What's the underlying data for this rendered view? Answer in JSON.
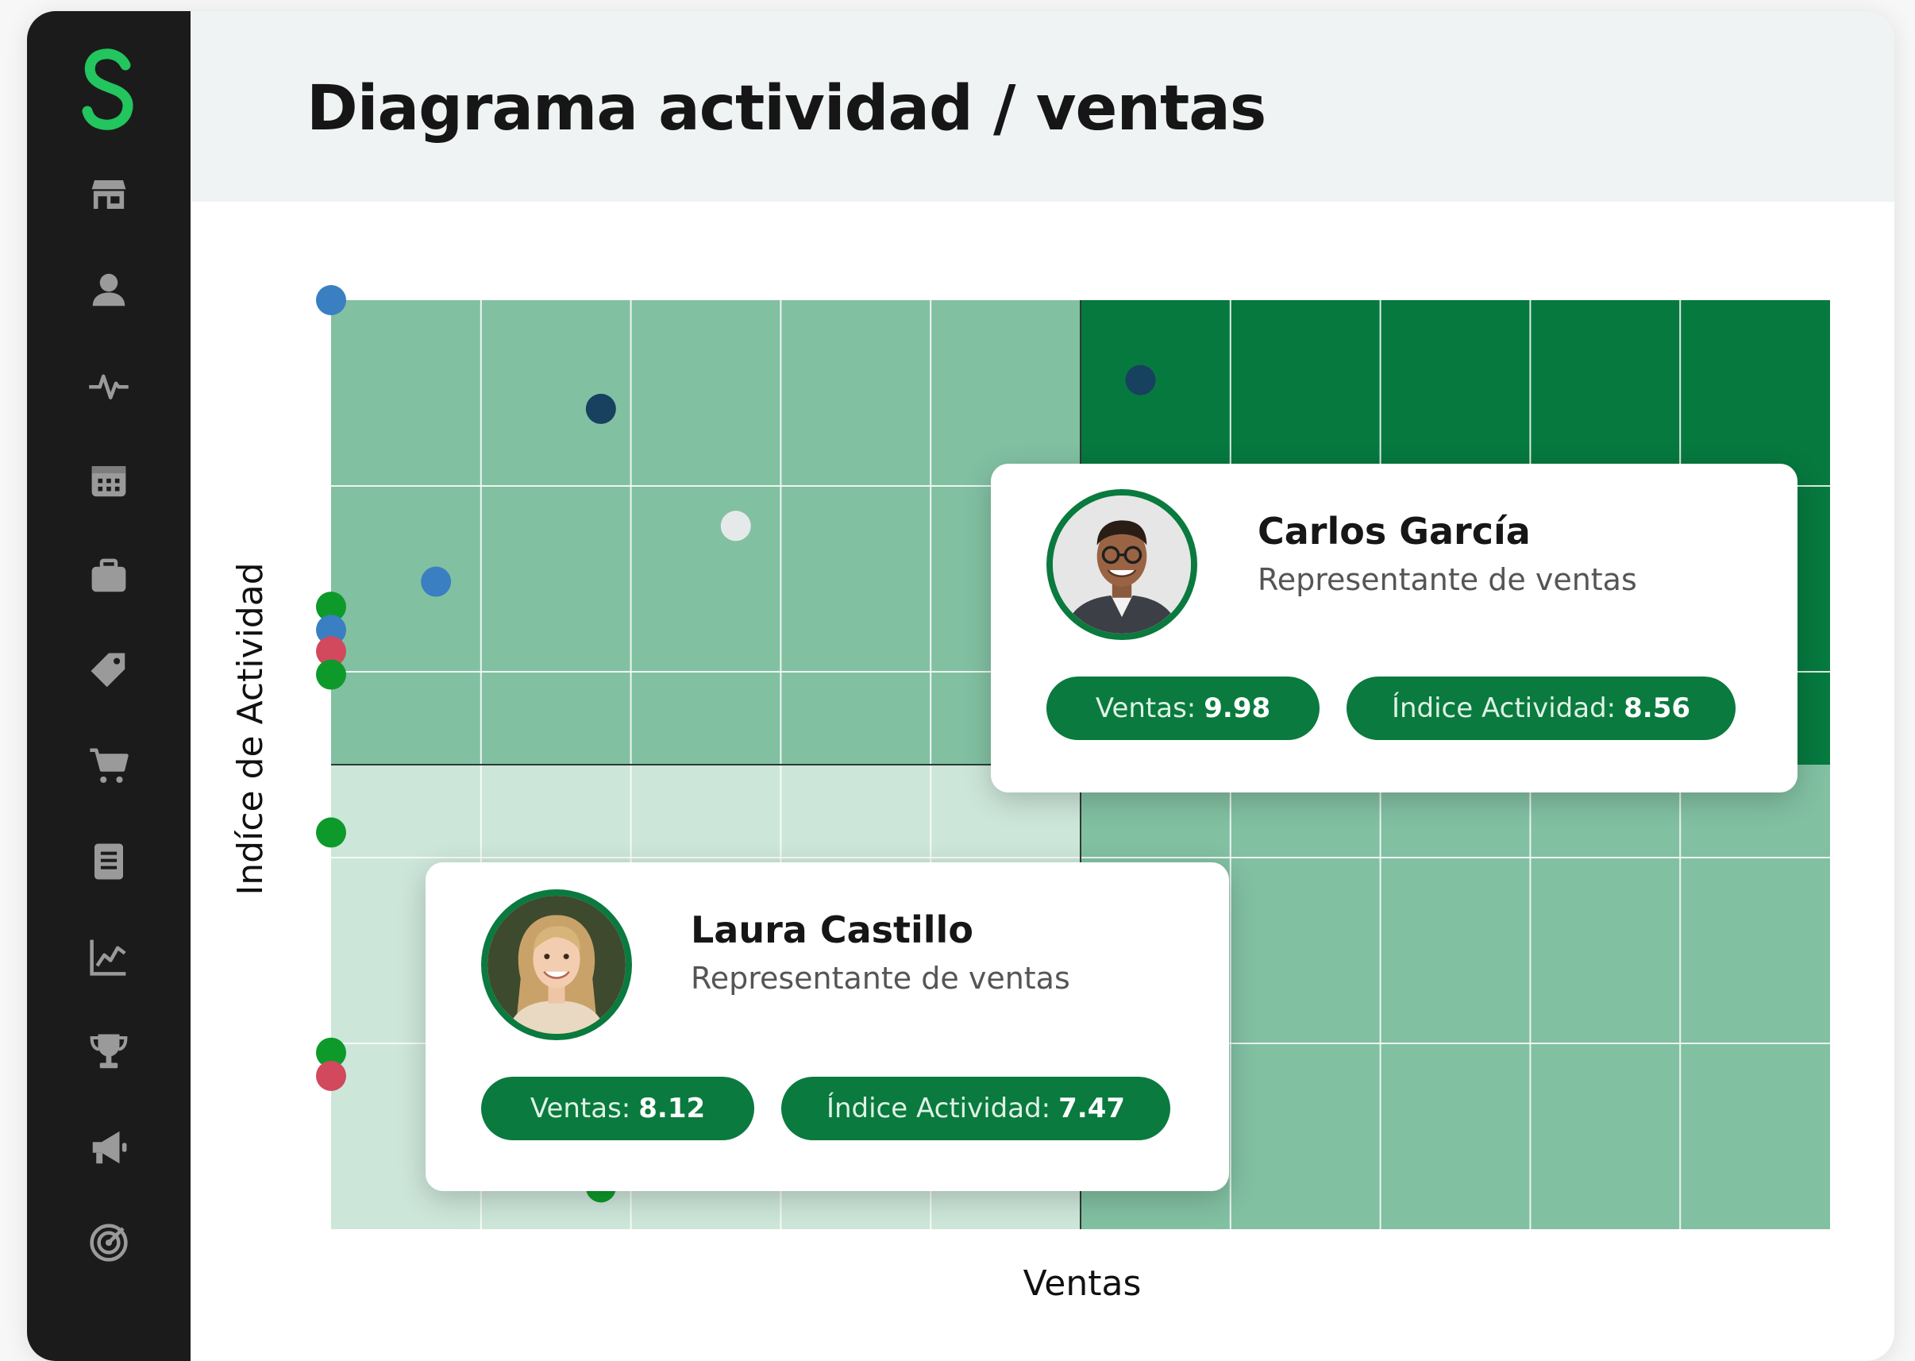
{
  "app": {
    "title": "Diagrama actividad / ventas",
    "logo_letter": "S",
    "brand_color": "#22c55e"
  },
  "sidebar": {
    "items": [
      {
        "name": "store-icon"
      },
      {
        "name": "user-icon"
      },
      {
        "name": "activity-icon"
      },
      {
        "name": "calendar-icon"
      },
      {
        "name": "briefcase-icon"
      },
      {
        "name": "tag-icon"
      },
      {
        "name": "cart-icon"
      },
      {
        "name": "document-icon"
      },
      {
        "name": "line-chart-icon"
      },
      {
        "name": "trophy-icon"
      },
      {
        "name": "megaphone-icon"
      },
      {
        "name": "target-icon"
      }
    ]
  },
  "chart_data": {
    "type": "scatter",
    "title": "Diagrama actividad / ventas",
    "xlabel": "Ventas",
    "ylabel": "Indíce de Actividad",
    "xlim": [
      0,
      10
    ],
    "ylim": [
      0,
      10
    ],
    "grid": true,
    "quadrant_split": {
      "x": 5,
      "y": 5
    },
    "quadrant_colors": {
      "top_left": "#82c0a2",
      "top_right": "#06793f",
      "bottom_left": "#cde6da",
      "bottom_right": "#82c0a2"
    },
    "points": [
      {
        "x": 0.0,
        "y": 10.0,
        "color": "#3a7fc2"
      },
      {
        "x": 1.8,
        "y": 8.83,
        "color": "#18405f"
      },
      {
        "x": 5.4,
        "y": 9.14,
        "color": "#18405f"
      },
      {
        "x": 2.7,
        "y": 7.57,
        "color": "#e6e9ea"
      },
      {
        "x": 0.7,
        "y": 6.97,
        "color": "#3a7fc2"
      },
      {
        "x": 0.0,
        "y": 6.7,
        "color": "#0d9a2a"
      },
      {
        "x": 0.0,
        "y": 6.45,
        "color": "#3a7fc2"
      },
      {
        "x": 0.0,
        "y": 6.22,
        "color": "#d2485d"
      },
      {
        "x": 0.0,
        "y": 5.97,
        "color": "#0d9a2a"
      },
      {
        "x": 0.0,
        "y": 4.27,
        "color": "#0d9a2a"
      },
      {
        "x": 0.0,
        "y": 1.9,
        "color": "#0d9a2a"
      },
      {
        "x": 0.0,
        "y": 1.65,
        "color": "#d2485d"
      },
      {
        "x": 1.8,
        "y": 0.45,
        "color": "#0d9a2a"
      }
    ]
  },
  "cards": [
    {
      "name": "Carlos García",
      "role": "Representante de ventas",
      "ventas_label": "Ventas:",
      "ventas_value": "9.98",
      "actividad_label": "Índice Actividad:",
      "actividad_value": "8.56"
    },
    {
      "name": "Laura Castillo",
      "role": "Representante de ventas",
      "ventas_label": "Ventas:",
      "ventas_value": "8.12",
      "actividad_label": "Índice Actividad:",
      "actividad_value": "7.47"
    }
  ]
}
